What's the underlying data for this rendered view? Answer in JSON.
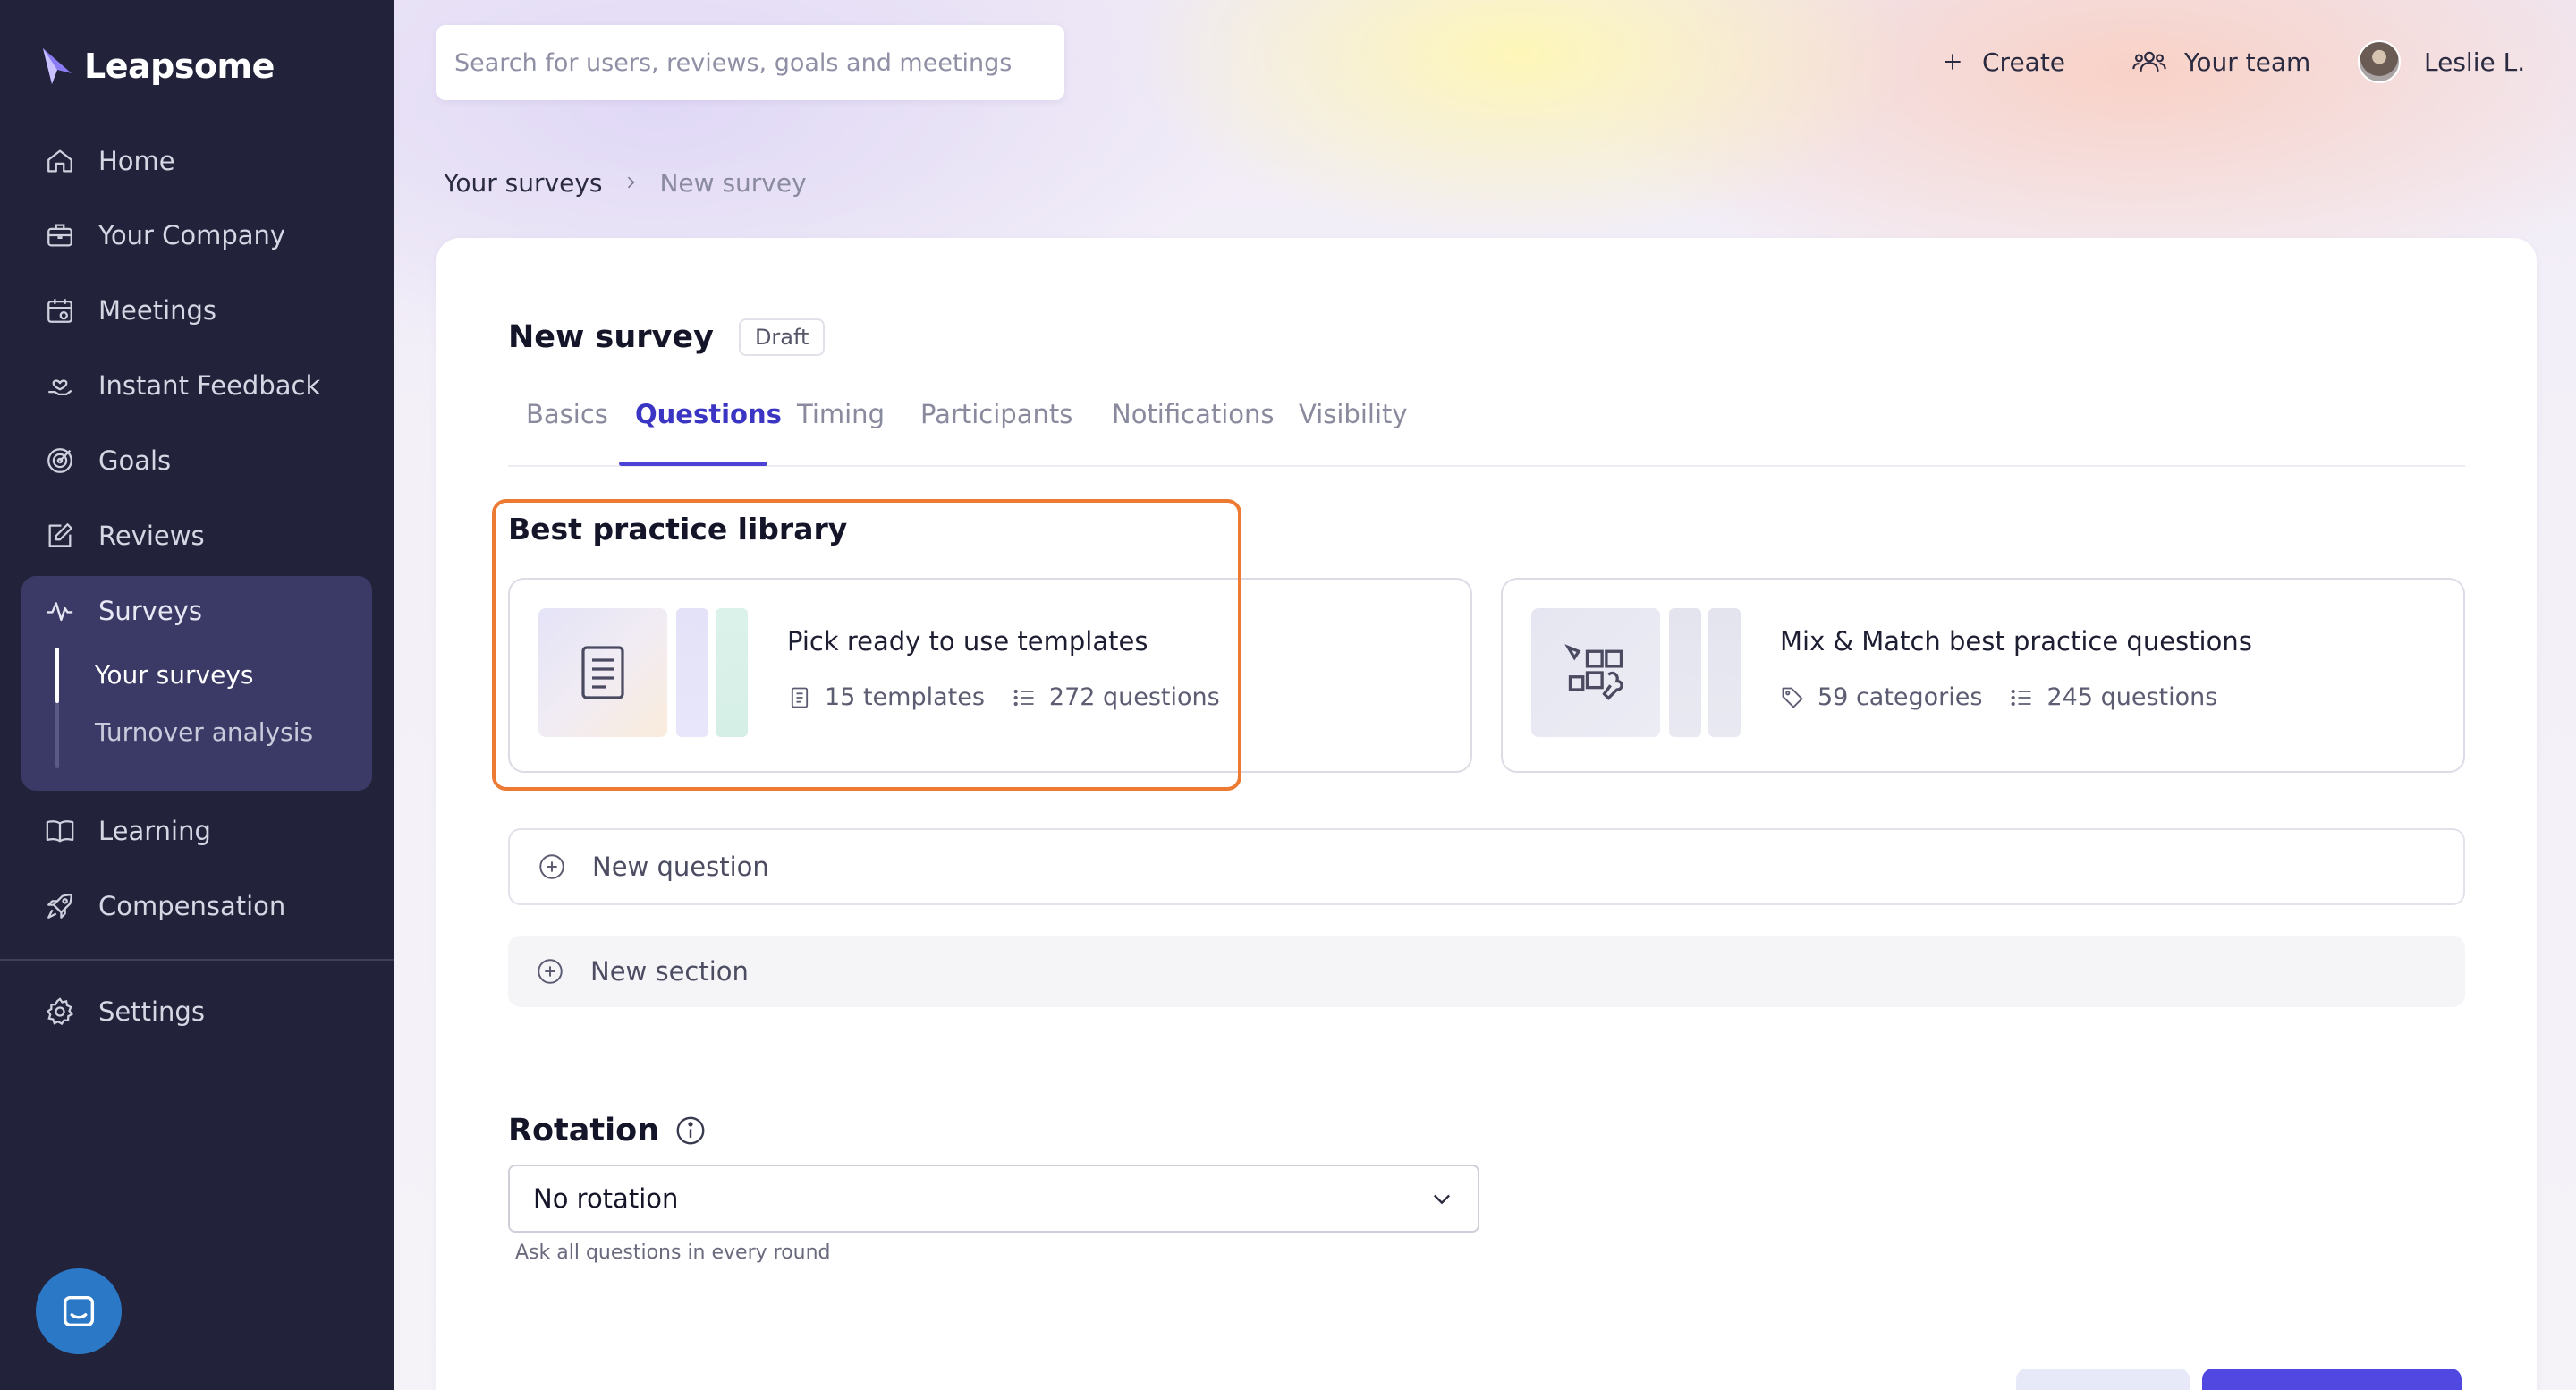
{
  "brand": {
    "name": "Leapsome",
    "accent": "#8b7cf6"
  },
  "sidebar": {
    "items": [
      {
        "label": "Home",
        "icon": "home-icon"
      },
      {
        "label": "Your Company",
        "icon": "briefcase-icon"
      },
      {
        "label": "Meetings",
        "icon": "calendar-icon"
      },
      {
        "label": "Instant Feedback",
        "icon": "hand-heart-icon"
      },
      {
        "label": "Goals",
        "icon": "target-icon"
      },
      {
        "label": "Reviews",
        "icon": "edit-icon"
      },
      {
        "label": "Surveys",
        "icon": "pulse-icon"
      },
      {
        "label": "Learning",
        "icon": "book-open-icon"
      },
      {
        "label": "Compensation",
        "icon": "rocket-icon"
      },
      {
        "label": "Settings",
        "icon": "gear-icon"
      }
    ],
    "surveys_sub": [
      {
        "label": "Your surveys"
      },
      {
        "label": "Turnover analysis"
      }
    ]
  },
  "topbar": {
    "search_placeholder": "Search for users, reviews, goals and meetings",
    "create_label": "Create",
    "team_label": "Your team",
    "user_name": "Leslie L."
  },
  "breadcrumb": {
    "parent": "Your surveys",
    "current": "New survey"
  },
  "survey": {
    "title": "New survey",
    "status": "Draft",
    "tabs": [
      {
        "label": "Basics"
      },
      {
        "label": "Questions"
      },
      {
        "label": "Timing"
      },
      {
        "label": "Participants"
      },
      {
        "label": "Notifications"
      },
      {
        "label": "Visibility"
      }
    ],
    "active_tab": "Questions"
  },
  "library": {
    "title": "Best practice library",
    "cards": [
      {
        "title": "Pick ready to use templates",
        "meta1": "15 templates",
        "meta2": "272 questions"
      },
      {
        "title": "Mix & Match best practice questions",
        "meta1": "59 categories",
        "meta2": "245 questions"
      }
    ]
  },
  "actions": {
    "new_question": "New question",
    "new_section": "New section"
  },
  "rotation": {
    "title": "Rotation",
    "selected": "No rotation",
    "hint": "Ask all questions in every round"
  },
  "colors": {
    "sidebar_bg": "#22233a",
    "primary": "#4a43d6",
    "highlight": "#ec7a33"
  }
}
